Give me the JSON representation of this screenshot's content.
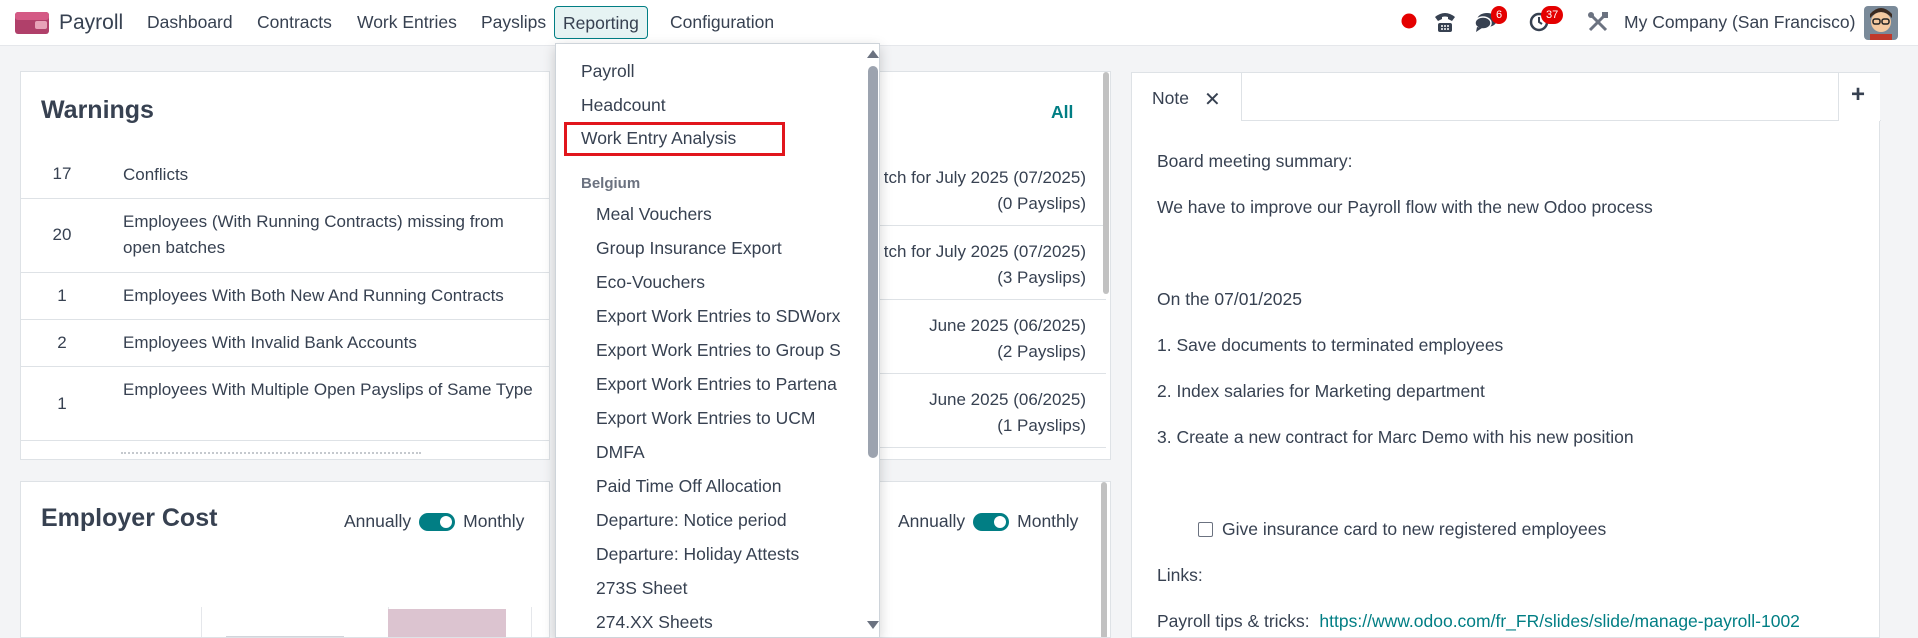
{
  "app": {
    "name": "Payroll",
    "menu": [
      "Dashboard",
      "Contracts",
      "Work Entries",
      "Payslips",
      "Reporting",
      "Configuration"
    ],
    "active_menu": "Reporting",
    "company": "My Company (San Francisco)",
    "badges": {
      "messages": "6",
      "activities": "37"
    }
  },
  "warnings": {
    "title": "Warnings",
    "rows": [
      {
        "count": "17",
        "label": "Conflicts"
      },
      {
        "count": "20",
        "label": "Employees (With Running Contracts) missing from open batches"
      },
      {
        "count": "1",
        "label": "Employees With Both New And Running Contracts"
      },
      {
        "count": "2",
        "label": "Employees With Invalid Bank Accounts"
      },
      {
        "count": "1",
        "label": "Employees With Multiple Open Payslips of Same Type"
      }
    ]
  },
  "batches": {
    "all_link": "All",
    "rows": [
      {
        "name": "tch for July 2025 (07/2025)",
        "payslips": "(0 Payslips)"
      },
      {
        "name": "tch for July 2025 (07/2025)",
        "payslips": "(3 Payslips)"
      },
      {
        "name": "June 2025 (06/2025)",
        "payslips": "(2 Payslips)"
      },
      {
        "name": "June 2025 (06/2025)",
        "payslips": "(1 Payslips)"
      }
    ]
  },
  "employer_cost": {
    "title": "Employer Cost",
    "toggle_left": "Annually",
    "toggle_right": "Monthly"
  },
  "second_toggle": {
    "left": "Annually",
    "right": "Monthly"
  },
  "reporting_dropdown": {
    "items": [
      "Payroll",
      "Headcount",
      "Work Entry Analysis"
    ],
    "highlighted": "Work Entry Analysis",
    "section": "Belgium",
    "section_items": [
      "Meal Vouchers",
      "Group Insurance Export",
      "Eco-Vouchers",
      "Export Work Entries to SDWorx",
      "Export Work Entries to Group S",
      "Export Work Entries to Partena",
      "Export Work Entries to UCM",
      "DMFA",
      "Paid Time Off Allocation",
      "Departure: Notice period",
      "Departure: Holiday Attests",
      "273S Sheet",
      "274.XX Sheets"
    ]
  },
  "note": {
    "tab_label": "Note",
    "lines": {
      "l1": "Board meeting summary:",
      "l2": "We have to improve our Payroll flow with the new Odoo process",
      "l3": "On the 07/01/2025",
      "l4": "1. Save documents to terminated employees",
      "l5": "2. Index salaries for Marketing department",
      "l6": "3. Create a new contract for Marc Demo with his new position",
      "checkbox": "Give insurance card to new registered employees",
      "links": "Links:",
      "tips_label": "Payroll tips & tricks:",
      "tips_url": "https://www.odoo.com/fr_FR/slides/slide/manage-payroll-1002"
    }
  },
  "colors": {
    "accent": "#017e84",
    "highlight_box": "#e1161c",
    "badge": "#e40000",
    "status_dot": "#e40000"
  },
  "icons": [
    "payroll-app-icon",
    "status-dot-icon",
    "phone-icon",
    "chat-icon",
    "clock-icon",
    "tools-icon",
    "avatar",
    "close-icon",
    "plus-icon",
    "chevron-up-icon",
    "chevron-down-icon"
  ]
}
